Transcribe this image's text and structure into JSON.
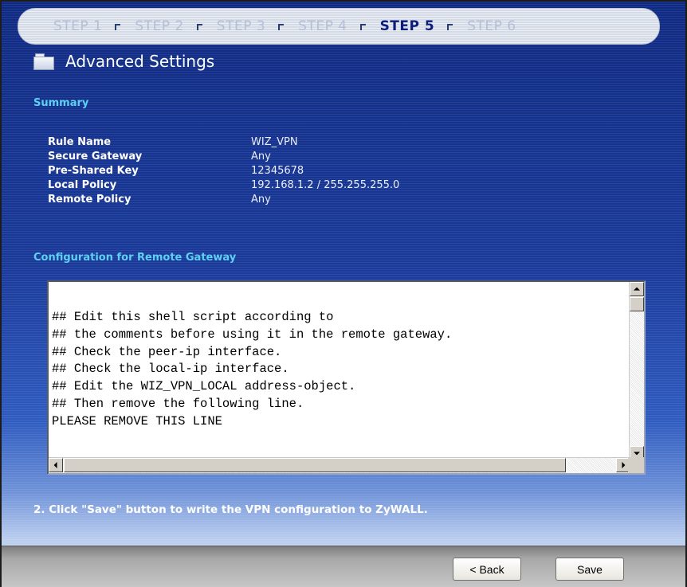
{
  "wizard": {
    "steps": [
      {
        "label": "STEP 1"
      },
      {
        "label": "STEP 2"
      },
      {
        "label": "STEP 3"
      },
      {
        "label": "STEP 4"
      },
      {
        "label": "STEP 5"
      },
      {
        "label": "STEP 6"
      }
    ],
    "active_step": 5
  },
  "page": {
    "title": "Advanced Settings",
    "icon": "folder-icon"
  },
  "summary": {
    "heading": "Summary",
    "rows": [
      {
        "label": "Rule Name",
        "value": "WIZ_VPN"
      },
      {
        "label": "Secure Gateway",
        "value": "Any"
      },
      {
        "label": "Pre-Shared Key",
        "value": "12345678"
      },
      {
        "label": "Local Policy",
        "value": "192.168.1.2 / 255.255.255.0"
      },
      {
        "label": "Remote Policy",
        "value": "Any"
      }
    ]
  },
  "config": {
    "heading": "Configuration for Remote Gateway",
    "script_lines": [
      "## Edit this shell script according to",
      "## the comments before using it in the remote gateway.",
      "## Check the peer-ip interface.",
      "## Check the local-ip interface.",
      "## Edit the WIZ_VPN_LOCAL address-object.",
      "## Then remove the following line.",
      "PLEASE REMOVE THIS LINE"
    ]
  },
  "instruction": "2. Click \"Save\" button to write the VPN configuration to ZyWALL.",
  "buttons": {
    "back": "< Back",
    "save": "Save"
  },
  "colors": {
    "section_heading": "#5ed0f2",
    "active_step": "#0b1d7a",
    "inactive_step": "#b3bfd6"
  }
}
